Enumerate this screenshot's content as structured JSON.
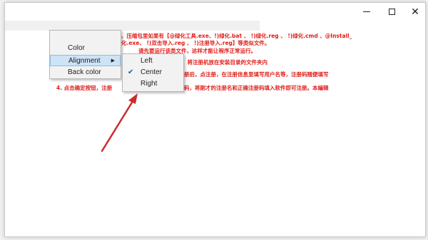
{
  "window": {
    "controls": {
      "minimize": "─",
      "maximize": "☐",
      "close": "✕"
    }
  },
  "document": {
    "lines": [
      "、压缩包里如果有【@绿化工具.exe、!)绿化.bat 、 !)绿化.reg 、 !)绿化.cmd 、@Install_",
      "化.exe、 !)双击导入.reg 、 !)注册导入.reg】等类似文件。",
      "请先要运行该类文件，这样才能让程序正常运行。",
      "，将注册机放在安装目录的文件夹内",
      "册后，点注册，在注册信息里填写用户名等，注册码随便填写",
      "4. 点击确定按钮，注册",
      "码，将刚才的注册名和正确注册码填入软件即可注册。本编辑"
    ],
    "text_color": "#e0201b"
  },
  "context_menu": {
    "items": [
      {
        "label": "Color"
      },
      {
        "label": "Alignment",
        "has_submenu": true
      },
      {
        "label": "Back color"
      }
    ]
  },
  "submenu": {
    "items": [
      {
        "label": "Left",
        "checked": false
      },
      {
        "label": "Center",
        "checked": true
      },
      {
        "label": "Right",
        "checked": false
      }
    ]
  },
  "annotation": {
    "arrow_color": "#cc2b2b"
  }
}
